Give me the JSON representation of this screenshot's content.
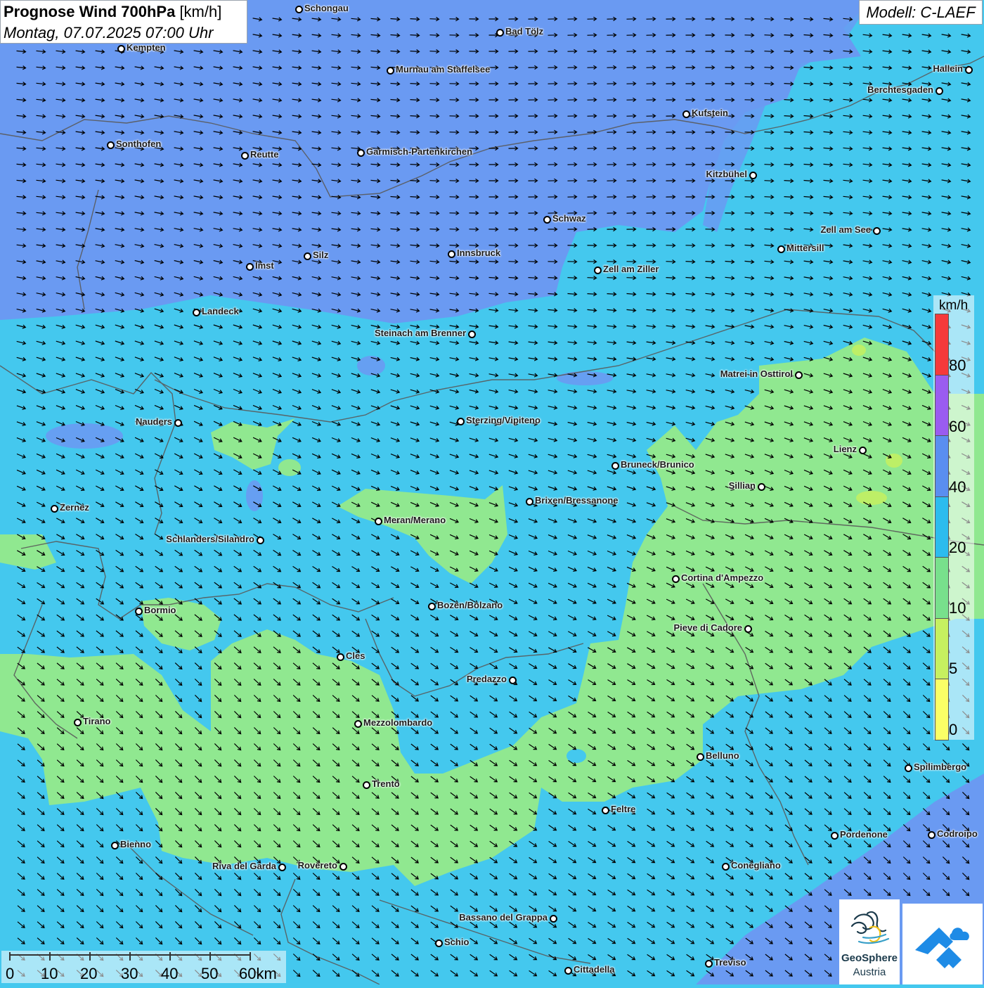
{
  "header": {
    "title_bold": "Prognose Wind 700hPa",
    "title_unit": "[km/h]",
    "subtitle": "Montag, 07.07.2025 07:00 Uhr",
    "model": "Modell: C-LAEF"
  },
  "legend": {
    "unit": "km/h",
    "ticks": [
      "80",
      "60",
      "40",
      "20",
      "10",
      "5",
      "0"
    ],
    "colors": [
      "#f53a3a",
      "#9a5cf0",
      "#5a8ef0",
      "#2cbcee",
      "#78e08c",
      "#c6f060",
      "#fbff66"
    ]
  },
  "scale": {
    "labels": [
      "0",
      "10",
      "20",
      "30",
      "40",
      "50",
      "60km"
    ]
  },
  "logos": {
    "geosphere_name": "GeoSphere",
    "geosphere_sub": "Austria",
    "logo1_icon": "geosphere-logo-icon",
    "logo2_icon": "mountain-cloud-icon"
  },
  "colors": {
    "wind_0_5": "#fbff66",
    "wind_5_10": "#c6f060",
    "wind_10_20": "#90e890",
    "wind_20_40": "#44c8ee",
    "wind_40_60": "#6a9af2",
    "border_lines": "#5a5a5a",
    "arrows": "#000000"
  },
  "cities": [
    {
      "name": "Schongau"
    },
    {
      "name": "Bad Tölz"
    },
    {
      "name": "Kempten"
    },
    {
      "name": "Murnau am Staffelsee"
    },
    {
      "name": "Hallein"
    },
    {
      "name": "Berchtesgaden"
    },
    {
      "name": "Kufstein"
    },
    {
      "name": "Sonthofen"
    },
    {
      "name": "Reutte"
    },
    {
      "name": "Garmisch-Partenkirchen"
    },
    {
      "name": "Kitzbühel"
    },
    {
      "name": "Schwaz"
    },
    {
      "name": "Zell am See"
    },
    {
      "name": "Mittersill"
    },
    {
      "name": "Innsbruck"
    },
    {
      "name": "Silz"
    },
    {
      "name": "Imst"
    },
    {
      "name": "Zell am Ziller"
    },
    {
      "name": "Landeck"
    },
    {
      "name": "Steinach am Brenner"
    },
    {
      "name": "Matrei in Osttirol"
    },
    {
      "name": "Nauders"
    },
    {
      "name": "Sterzing/Vipiteno"
    },
    {
      "name": "Lienz"
    },
    {
      "name": "Bruneck/Brunico"
    },
    {
      "name": "Sillian"
    },
    {
      "name": "Brixen/Bressanone"
    },
    {
      "name": "Zernez"
    },
    {
      "name": "Meran/Merano"
    },
    {
      "name": "Schlanders/Silandro"
    },
    {
      "name": "Cortina d'Ampezzo"
    },
    {
      "name": "Bozen/Bolzano"
    },
    {
      "name": "Bormio"
    },
    {
      "name": "Pieve di Cadore"
    },
    {
      "name": "Cles"
    },
    {
      "name": "Predazzo"
    },
    {
      "name": "Tirano"
    },
    {
      "name": "Mezzolombardo"
    },
    {
      "name": "Belluno"
    },
    {
      "name": "Spilimbergo"
    },
    {
      "name": "Trento"
    },
    {
      "name": "Feltre"
    },
    {
      "name": "Pordenone"
    },
    {
      "name": "Codroipo"
    },
    {
      "name": "Bienno"
    },
    {
      "name": "Riva del Garda"
    },
    {
      "name": "Rovereto"
    },
    {
      "name": "Conegliano"
    },
    {
      "name": "Bassano del Grappa"
    },
    {
      "name": "Schio"
    },
    {
      "name": "Treviso"
    },
    {
      "name": "Cittadella"
    }
  ]
}
